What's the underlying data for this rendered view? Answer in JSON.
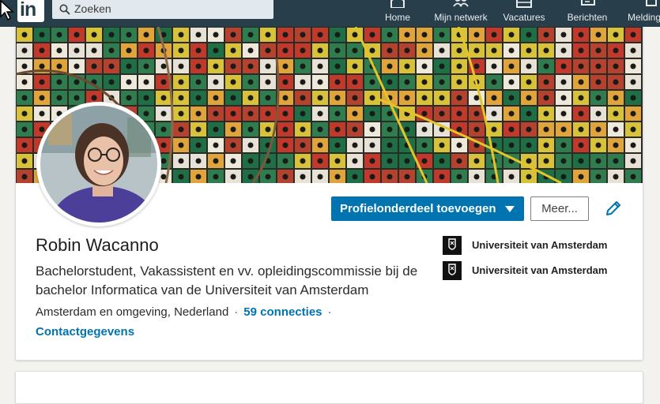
{
  "nav": {
    "logo": "in",
    "search_value": "Zoeken",
    "items": [
      {
        "label": "Home",
        "icon": "home-icon"
      },
      {
        "label": "Mijn netwerk",
        "icon": "network-icon"
      },
      {
        "label": "Vacatures",
        "icon": "briefcase-icon"
      },
      {
        "label": "Berichten",
        "icon": "messaging-icon"
      },
      {
        "label": "Meldingen",
        "icon": "bell-icon"
      }
    ]
  },
  "profile": {
    "name": "Robin Wacanno",
    "headline": "Bachelorstudent, Vakassistent en vv. opleidingscommissie bij de bachelor Informatica van de Universiteit van Amsterdam",
    "location": "Amsterdam en omgeving, Nederland",
    "connections": "59 connecties",
    "separator": "·",
    "contact_info": "Contactgegevens",
    "add_section_button": "Profielonderdeel toevoegen",
    "more_button": "Meer...",
    "education": [
      {
        "name": "Universiteit van Amsterdam",
        "logo": "uva-logo"
      },
      {
        "name": "Universiteit van Amsterdam",
        "logo": "uva-logo"
      }
    ]
  },
  "colors": {
    "nav_bg": "#283e4a",
    "primary": "#0073b1",
    "page_bg": "#f3f2ef"
  }
}
